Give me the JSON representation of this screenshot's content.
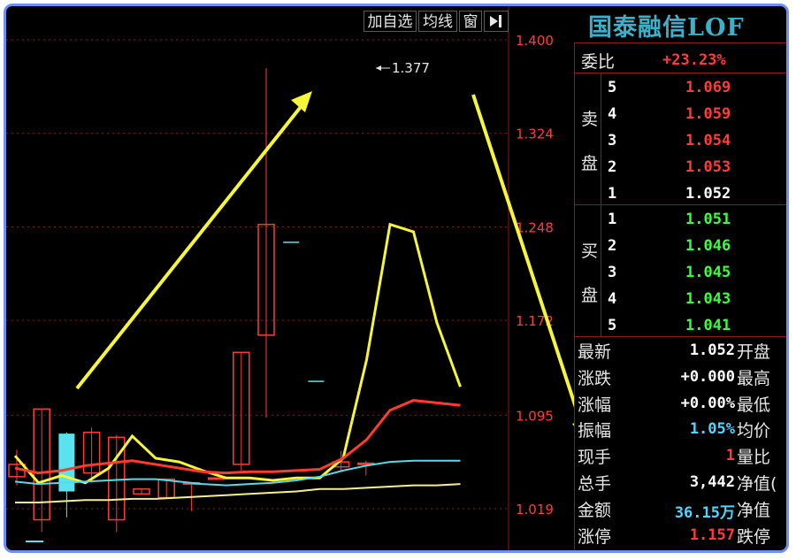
{
  "toolbar": {
    "add_watch": "加自选",
    "ma": "均线",
    "window": "窗",
    "arrow_icon": "arrow-right-bar"
  },
  "price_axis": {
    "labels": [
      "1.400",
      "1.324",
      "1.248",
      "1.172",
      "1.095",
      "1.019"
    ]
  },
  "annotation": {
    "high_marker": "1.377"
  },
  "chart_data": {
    "type": "candlestick",
    "ylim": [
      0.98,
      1.4
    ],
    "yticks": [
      1.4,
      1.324,
      1.248,
      1.172,
      1.095,
      1.019
    ],
    "candles": [
      {
        "o": 1.055,
        "h": 1.067,
        "l": 1.038,
        "c": 1.045,
        "color": "red"
      },
      {
        "o": 1.1,
        "h": 1.1,
        "l": 1.0,
        "c": 1.01,
        "color": "red"
      },
      {
        "o": 1.08,
        "h": 1.081,
        "l": 1.012,
        "c": 1.033,
        "color": "cyan"
      },
      {
        "o": 1.081,
        "h": 1.085,
        "l": 1.04,
        "c": 1.048,
        "color": "red"
      },
      {
        "o": 1.077,
        "h": 1.079,
        "l": 1.0,
        "c": 1.01,
        "color": "red"
      },
      {
        "o": 1.035,
        "h": 1.035,
        "l": 1.031,
        "c": 1.031,
        "color": "red"
      },
      {
        "o": 1.043,
        "h": 1.043,
        "l": 1.027,
        "c": 1.028,
        "color": "red"
      },
      {
        "o": 1.04,
        "h": 1.04,
        "l": 1.017,
        "c": 1.04,
        "color": "red"
      },
      {
        "o": 1.044,
        "h": 1.044,
        "l": 1.044,
        "c": 1.044,
        "color": "red"
      },
      {
        "o": 1.146,
        "h": 1.146,
        "l": 1.05,
        "c": 1.055,
        "color": "red"
      },
      {
        "o": 1.25,
        "h": 1.377,
        "l": 1.093,
        "c": 1.16,
        "color": "red"
      },
      {
        "o": 1.236,
        "h": 1.236,
        "l": 1.236,
        "c": 1.236,
        "color": "cyan"
      },
      {
        "o": 1.123,
        "h": 1.123,
        "l": 1.123,
        "c": 1.123,
        "color": "cyan"
      },
      {
        "o": 1.057,
        "h": 1.066,
        "l": 1.05,
        "c": 1.053,
        "color": "red"
      },
      {
        "o": 1.056,
        "h": 1.058,
        "l": 1.046,
        "c": 1.056,
        "color": "red"
      }
    ],
    "series": [
      {
        "color": "#f5f53a",
        "values": [
          1.062,
          1.04,
          1.046,
          1.04,
          1.052,
          1.078,
          1.06,
          1.057,
          1.05,
          1.044,
          1.044,
          1.042,
          1.044,
          1.044,
          1.06,
          1.14,
          1.25,
          1.244,
          1.17,
          1.118
        ]
      },
      {
        "color": "#ff3b30",
        "values": [
          1.052,
          1.048,
          1.05,
          1.054,
          1.056,
          1.058,
          1.055,
          1.052,
          1.049,
          1.048,
          1.049,
          1.049,
          1.05,
          1.051,
          1.06,
          1.075,
          1.099,
          1.107,
          1.105,
          1.103
        ]
      },
      {
        "color": "#59d9e6",
        "values": [
          1.041,
          1.039,
          1.04,
          1.041,
          1.042,
          1.043,
          1.043,
          1.041,
          1.039,
          1.038,
          1.039,
          1.04,
          1.042,
          1.045,
          1.05,
          1.054,
          1.057,
          1.058,
          1.058,
          1.058
        ]
      },
      {
        "color": "#f7f08a",
        "values": [
          1.024,
          1.024,
          1.025,
          1.026,
          1.026,
          1.027,
          1.027,
          1.028,
          1.029,
          1.03,
          1.031,
          1.032,
          1.033,
          1.035,
          1.035,
          1.036,
          1.037,
          1.038,
          1.038,
          1.039
        ]
      }
    ]
  },
  "panel": {
    "title": "国泰融信LOF",
    "webi": {
      "label": "委比",
      "value": "+23.23%"
    },
    "sell": {
      "label_1": "卖",
      "label_2": "盘",
      "rows": [
        {
          "level": "5",
          "price": "1.069"
        },
        {
          "level": "4",
          "price": "1.059"
        },
        {
          "level": "3",
          "price": "1.054"
        },
        {
          "level": "2",
          "price": "1.053"
        },
        {
          "level": "1",
          "price": "1.052"
        }
      ]
    },
    "buy": {
      "label_1": "买",
      "label_2": "盘",
      "rows": [
        {
          "level": "1",
          "price": "1.051"
        },
        {
          "level": "2",
          "price": "1.046"
        },
        {
          "level": "3",
          "price": "1.045"
        },
        {
          "level": "4",
          "price": "1.043"
        },
        {
          "level": "5",
          "price": "1.041"
        }
      ]
    },
    "stats": [
      {
        "label": "最新",
        "value": "1.052",
        "label2": "开盘"
      },
      {
        "label": "涨跌",
        "value": "+0.000",
        "label2": "最高"
      },
      {
        "label": "涨幅",
        "value": "+0.00%",
        "label2": "最低"
      },
      {
        "label": "振幅",
        "value": "1.05%",
        "label2": "均价"
      },
      {
        "label": "现手",
        "value": "1",
        "label2": "量比"
      },
      {
        "label": "总手",
        "value": "3,442",
        "label2": "净值("
      },
      {
        "label": "金额",
        "value": "36.15万",
        "label2": "净值"
      },
      {
        "label": "涨停",
        "value": "1.157",
        "label2": "跌停"
      }
    ]
  },
  "colors": {
    "up": "#ff3b3b",
    "down": "#3cff3c",
    "accent": "#6f8ff6",
    "grid": "#8b1a1a"
  }
}
